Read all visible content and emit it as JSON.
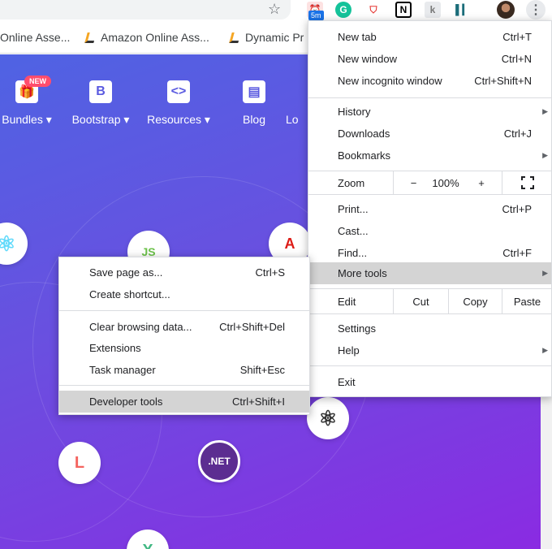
{
  "toolbar": {
    "ext_badge": "5m",
    "ext_notion": "N",
    "ext_k": "k",
    "ext_grammarly": "G",
    "menu_glyph": "⋮",
    "star_glyph": "☆"
  },
  "bookmarks": [
    {
      "label": "Online Asse..."
    },
    {
      "label": "Amazon Online Ass..."
    },
    {
      "label": "Dynamic Pr"
    }
  ],
  "nav": [
    {
      "label": "Bundles ▾",
      "glyph": "🎁",
      "badge": "NEW"
    },
    {
      "label": "Bootstrap ▾",
      "glyph": "B"
    },
    {
      "label": "Resources ▾",
      "glyph": "<>"
    },
    {
      "label": "Blog",
      "glyph": "▤"
    },
    {
      "label": "Lo"
    }
  ],
  "logos": {
    "react": "⚛",
    "node": "JS",
    "angular": "A",
    "react2": "⚛",
    "laravel": "L",
    "dotnet": ".NET",
    "vue": "X"
  },
  "chrome_menu": {
    "new_tab": {
      "label": "New tab",
      "shortcut": "Ctrl+T"
    },
    "new_window": {
      "label": "New window",
      "shortcut": "Ctrl+N"
    },
    "new_incognito": {
      "label": "New incognito window",
      "shortcut": "Ctrl+Shift+N"
    },
    "history": {
      "label": "History"
    },
    "downloads": {
      "label": "Downloads",
      "shortcut": "Ctrl+J"
    },
    "bookmarks": {
      "label": "Bookmarks"
    },
    "zoom": {
      "label": "Zoom",
      "minus": "−",
      "value": "100%",
      "plus": "+"
    },
    "print": {
      "label": "Print...",
      "shortcut": "Ctrl+P"
    },
    "cast": {
      "label": "Cast..."
    },
    "find": {
      "label": "Find...",
      "shortcut": "Ctrl+F"
    },
    "more_tools": {
      "label": "More tools"
    },
    "edit": {
      "label": "Edit",
      "cut": "Cut",
      "copy": "Copy",
      "paste": "Paste"
    },
    "settings": {
      "label": "Settings"
    },
    "help": {
      "label": "Help"
    },
    "exit": {
      "label": "Exit"
    }
  },
  "submenu": {
    "save_page": {
      "label": "Save page as...",
      "shortcut": "Ctrl+S"
    },
    "create_shortcut": {
      "label": "Create shortcut..."
    },
    "clear_browsing": {
      "label": "Clear browsing data...",
      "shortcut": "Ctrl+Shift+Del"
    },
    "extensions": {
      "label": "Extensions"
    },
    "task_manager": {
      "label": "Task manager",
      "shortcut": "Shift+Esc"
    },
    "developer_tools": {
      "label": "Developer tools",
      "shortcut": "Ctrl+Shift+I"
    }
  },
  "arrow_glyph": "▶"
}
